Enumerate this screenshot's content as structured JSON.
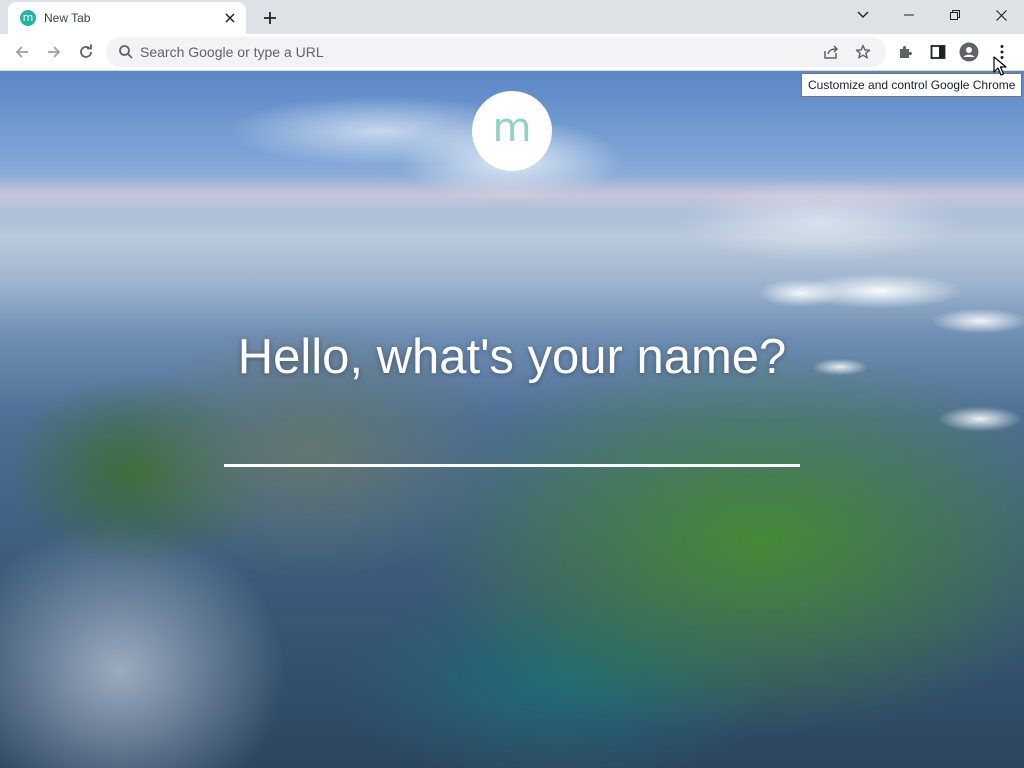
{
  "tab": {
    "title": "New Tab",
    "favicon_letter": "m",
    "favicon_color": "#1fb5a3"
  },
  "window_controls": {
    "icons": [
      "chevron-down-icon",
      "minimize-icon",
      "restore-icon",
      "close-icon"
    ]
  },
  "toolbar": {
    "omnibox_placeholder": "Search Google or type a URL",
    "icons": [
      "back-icon",
      "forward-icon",
      "reload-icon",
      "search-icon",
      "share-icon",
      "star-icon",
      "extensions-icon",
      "side-panel-icon",
      "profile-icon",
      "menu-icon"
    ]
  },
  "tooltip": {
    "text": "Customize and control Google Chrome"
  },
  "page": {
    "logo_letter": "m",
    "logo_color": "#8fd3c8",
    "greeting": "Hello, what's your name?",
    "name_value": ""
  }
}
